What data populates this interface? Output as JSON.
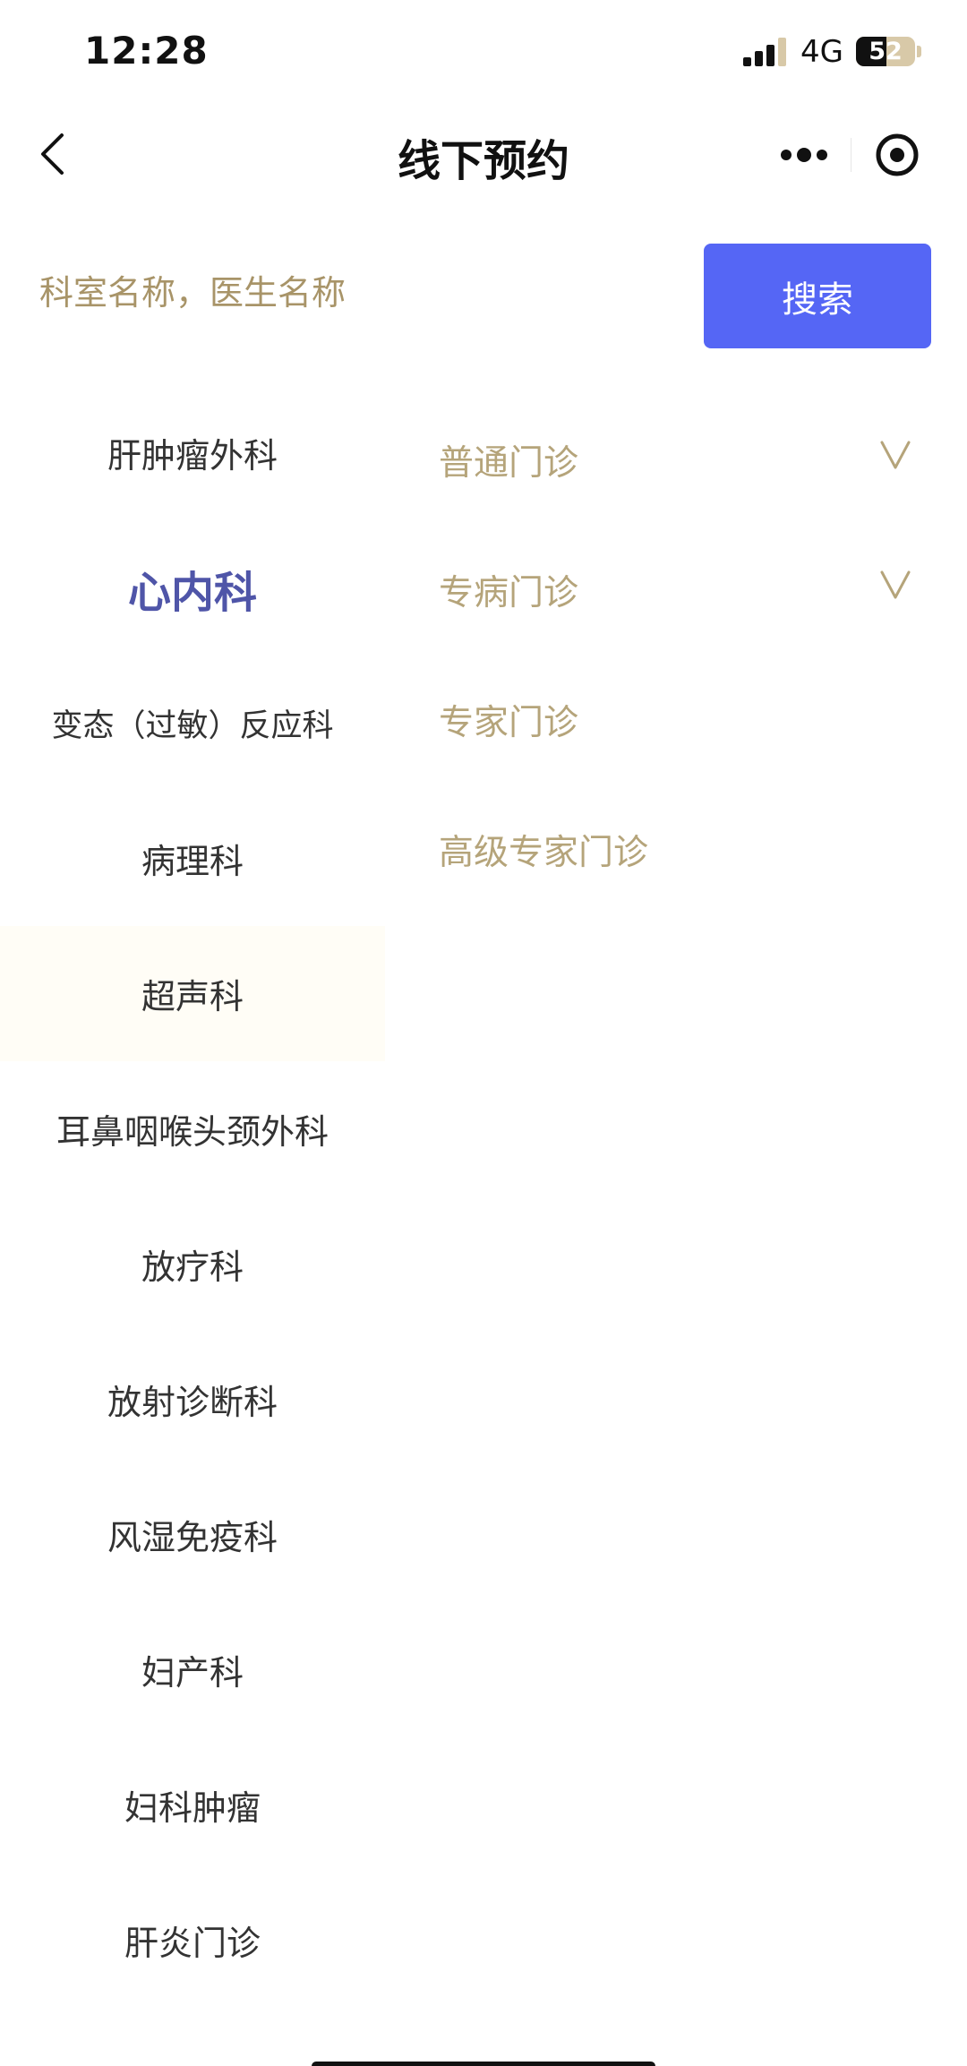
{
  "status_bar": {
    "time": "12:28",
    "network": "4G",
    "battery": {
      "percent": 52,
      "label": "52"
    }
  },
  "nav": {
    "title": "线下预约",
    "back_icon": "chevron-left-icon",
    "more_icon": "more-dots-icon",
    "close_icon": "target-circle-icon"
  },
  "search": {
    "placeholder": "科室名称，医生名称",
    "value": "",
    "button_label": "搜索"
  },
  "departments": [
    {
      "label": "肝肿瘤外科"
    },
    {
      "label": "心内科",
      "active": true
    },
    {
      "label": "变态（过敏）反应科"
    },
    {
      "label": "病理科"
    },
    {
      "label": "超声科"
    },
    {
      "label": "耳鼻咽喉头颈外科"
    },
    {
      "label": "放疗科"
    },
    {
      "label": "放射诊断科"
    },
    {
      "label": "风湿免疫科"
    },
    {
      "label": "妇产科"
    },
    {
      "label": "妇科肿瘤"
    },
    {
      "label": "肝炎门诊"
    }
  ],
  "clinic_types": [
    {
      "label": "普通门诊",
      "expandable": true,
      "chevron": "V"
    },
    {
      "label": "专病门诊",
      "expandable": true,
      "chevron": "V"
    },
    {
      "label": "专家门诊",
      "expandable": false
    },
    {
      "label": "高级专家门诊",
      "expandable": false
    }
  ],
  "colors": {
    "primary_button": "#5566f5",
    "active_department": "#4f55a8",
    "clinic_text": "#b5a47a",
    "placeholder": "#a89468"
  }
}
